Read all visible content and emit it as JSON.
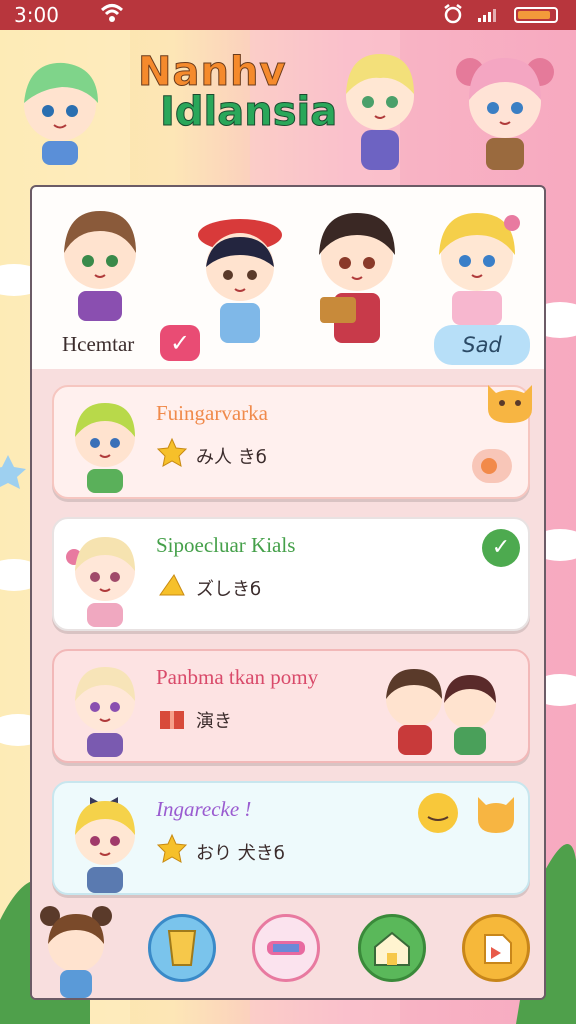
{
  "status": {
    "time": "3:00"
  },
  "app": {
    "title_line1": "Nanhv",
    "title_line2": "Idlansia"
  },
  "header": {
    "left_label": "Hcemtar",
    "right_badge": "Sad",
    "check_symbol": "✓"
  },
  "cards": [
    {
      "title": "Fuingarvarka",
      "subtitle": "み人 きб",
      "title_color": "#f08a4b",
      "bg": "#fff0ee"
    },
    {
      "title": "Sipoecluar Kials",
      "subtitle": "ズしきб",
      "title_color": "#45a04a",
      "bg": "#ffffff"
    },
    {
      "title": "Panbma tkan pomy",
      "subtitle": "演き",
      "title_color": "#d94a6a",
      "bg": "#fde3e3"
    },
    {
      "title": "Ingarecke !",
      "subtitle": "おり 犬きб",
      "title_color": "#9a5bd0",
      "bg": "#eefafc"
    }
  ],
  "colors": {
    "statusbar": "#b8363d",
    "panel_bg": "#f8dede",
    "accent_pink": "#e94c74",
    "accent_green": "#4daa4f"
  },
  "icons": [
    "wifi-icon",
    "alarm-icon",
    "signal-icon",
    "battery-icon",
    "star-icon",
    "gift-icon",
    "drink-icon",
    "candy-icon",
    "house-icon",
    "home-icon"
  ]
}
